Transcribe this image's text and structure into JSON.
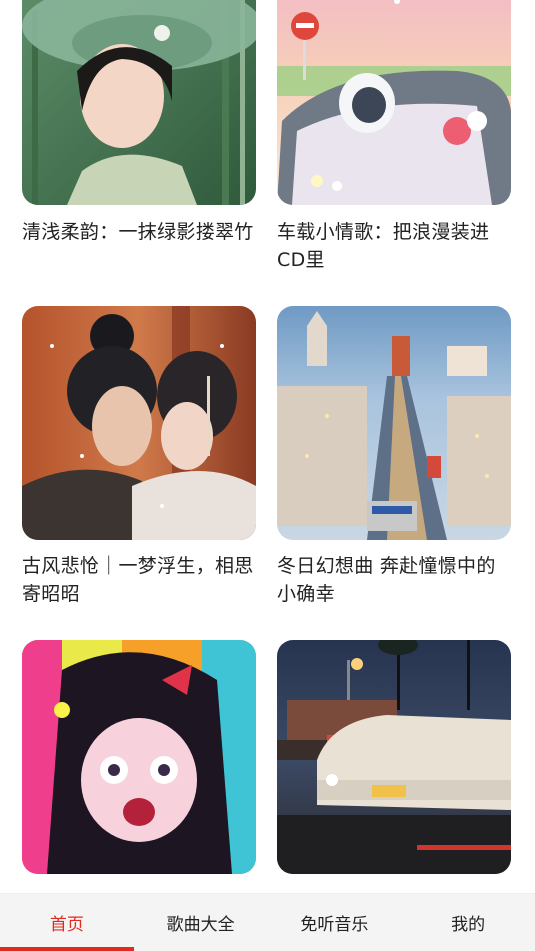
{
  "playlists": [
    {
      "title": "清浅柔韵：一抹绿影搂翠竹",
      "image": "woman-green-hat-bamboo-cover"
    },
    {
      "title": "车载小情歌：把浪漫装进CD里",
      "image": "convertible-car-flowers-cover"
    },
    {
      "title": "古风悲怆｜一梦浮生，相思寄昭昭",
      "image": "ancient-couple-snow-cover"
    },
    {
      "title": "冬日幻想曲 奔赴憧憬中的小确幸",
      "image": "winter-city-tram-cover"
    },
    {
      "title": "",
      "image": "anime-girl-colorful-cover"
    },
    {
      "title": "",
      "image": "vintage-car-street-night-cover"
    }
  ],
  "tabbar": {
    "tabs": [
      {
        "label": "首页",
        "active": true
      },
      {
        "label": "歌曲大全",
        "active": false
      },
      {
        "label": "免听音乐",
        "active": false
      },
      {
        "label": "我的",
        "active": false
      }
    ],
    "accent_color": "#e02b20"
  }
}
